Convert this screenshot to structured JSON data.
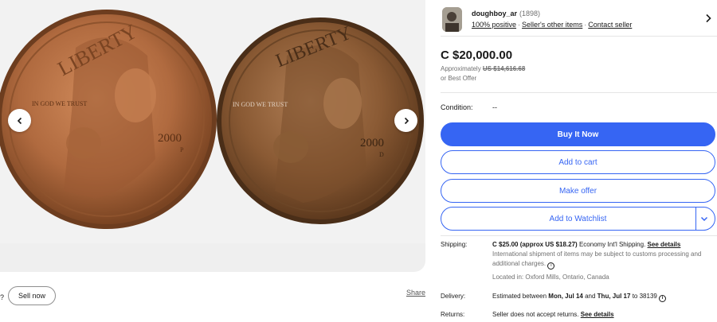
{
  "gallery": {
    "coin_left": {
      "motto": "IN GOD WE TRUST",
      "legend": "LIBERTY",
      "year": "2000",
      "mint": "P"
    },
    "coin_right": {
      "motto": "IN GOD WE TRUST",
      "legend": "LIBERTY",
      "year": "2000",
      "mint": "D"
    }
  },
  "below_gallery": {
    "question_fragment": "?",
    "sell_now_label": "Sell now",
    "share_label": "Share"
  },
  "seller": {
    "name": "doughboy_ar",
    "feedback_count": "(1898)",
    "positive": "100% positive",
    "other_items": "Seller's other items",
    "contact": "Contact seller",
    "separator": "·"
  },
  "price": {
    "main": "C $20,000.00",
    "approx_prefix": "Approximately",
    "approx_value": "US $14,616.68",
    "best_offer": "or Best Offer"
  },
  "condition": {
    "label": "Condition:",
    "value": "--"
  },
  "actions": {
    "buy_now": "Buy It Now",
    "add_to_cart": "Add to cart",
    "make_offer": "Make offer",
    "add_to_watchlist": "Add to Watchlist"
  },
  "shipping": {
    "label": "Shipping:",
    "cost": "C $25.00 (approx US $18.27)",
    "service": "Economy Int'l Shipping.",
    "see_details": "See details",
    "note": "International shipment of items may be subject to customs processing and additional charges.",
    "location": "Located in: Oxford Mills, Ontario, Canada"
  },
  "delivery": {
    "label": "Delivery:",
    "prefix": "Estimated between",
    "start": "Mon, Jul 14",
    "and": "and",
    "end": "Thu, Jul 17",
    "suffix": "to 38139"
  },
  "returns": {
    "label": "Returns:",
    "text": "Seller does not accept returns.",
    "see_details": "See details"
  },
  "colors": {
    "accent": "#3665f3",
    "coin_left": "#b06a3f",
    "coin_right": "#8a5a34"
  },
  "icons": {
    "prev": "chevron-left-icon",
    "next": "chevron-right-icon",
    "seller_chevron": "chevron-right-icon",
    "watch_chevron": "chevron-down-icon",
    "info": "info-icon"
  }
}
